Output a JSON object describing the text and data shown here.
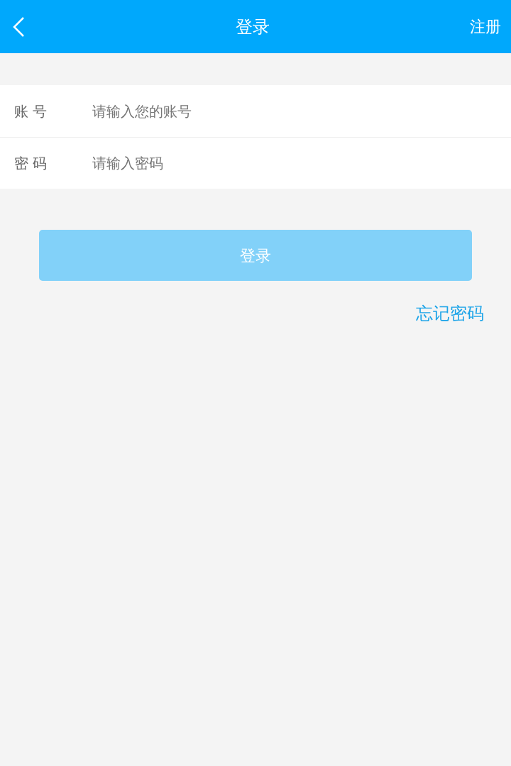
{
  "header": {
    "title": "登录",
    "action": "注册"
  },
  "fields": [
    {
      "label": "账 号",
      "placeholder": "请输入您的账号"
    },
    {
      "label": "密 码",
      "placeholder": "请输入密码"
    }
  ],
  "login_button": {
    "label": "登录",
    "disabled": true
  },
  "forgot_link": "忘记密码"
}
